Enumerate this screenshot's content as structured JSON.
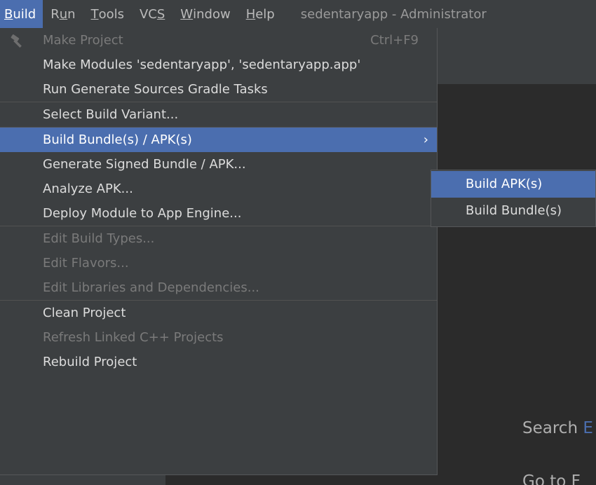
{
  "menubar": {
    "items": [
      {
        "mnemonic": "B",
        "rest": "uild"
      },
      {
        "prefix": "R",
        "mnemonic": "u",
        "rest": "n"
      },
      {
        "mnemonic": "T",
        "rest": "ools"
      },
      {
        "prefix": "VC",
        "mnemonic": "S",
        "rest": ""
      },
      {
        "mnemonic": "W",
        "rest": "indow"
      },
      {
        "mnemonic": "H",
        "rest": "elp"
      }
    ],
    "window_title": "sedentaryapp - Administrator"
  },
  "build_menu": {
    "make_project": {
      "label": "Make Project",
      "shortcut": "Ctrl+F9",
      "icon": "hammer-icon"
    },
    "make_modules": "Make Modules 'sedentaryapp', 'sedentaryapp.app'",
    "run_generate_sources": "Run Generate Sources Gradle Tasks",
    "select_build_variant": "Select Build Variant...",
    "build_bundle_apk": {
      "label": "Build Bundle(s) / APK(s)",
      "arrow": "›"
    },
    "generate_signed": "Generate Signed Bundle / APK...",
    "analyze_apk": "Analyze APK...",
    "deploy_module": "Deploy Module to App Engine...",
    "edit_build_types": "Edit Build Types...",
    "edit_flavors": "Edit Flavors...",
    "edit_libraries": "Edit Libraries and Dependencies...",
    "clean_project": "Clean Project",
    "refresh_linked": "Refresh Linked C++ Projects",
    "rebuild_project": "Rebuild Project"
  },
  "submenu": {
    "build_apks": "Build APK(s)",
    "build_bundles": "Build Bundle(s)"
  },
  "background": {
    "search_hint_prefix": "Search ",
    "search_hint_cut": "E",
    "goto_hint": "Go to F"
  },
  "colors": {
    "selection": "#4b6eaf",
    "menu_bg": "#3c3f41",
    "editor_bg": "#2b2b2b",
    "disabled_text": "#7a7a7a"
  }
}
